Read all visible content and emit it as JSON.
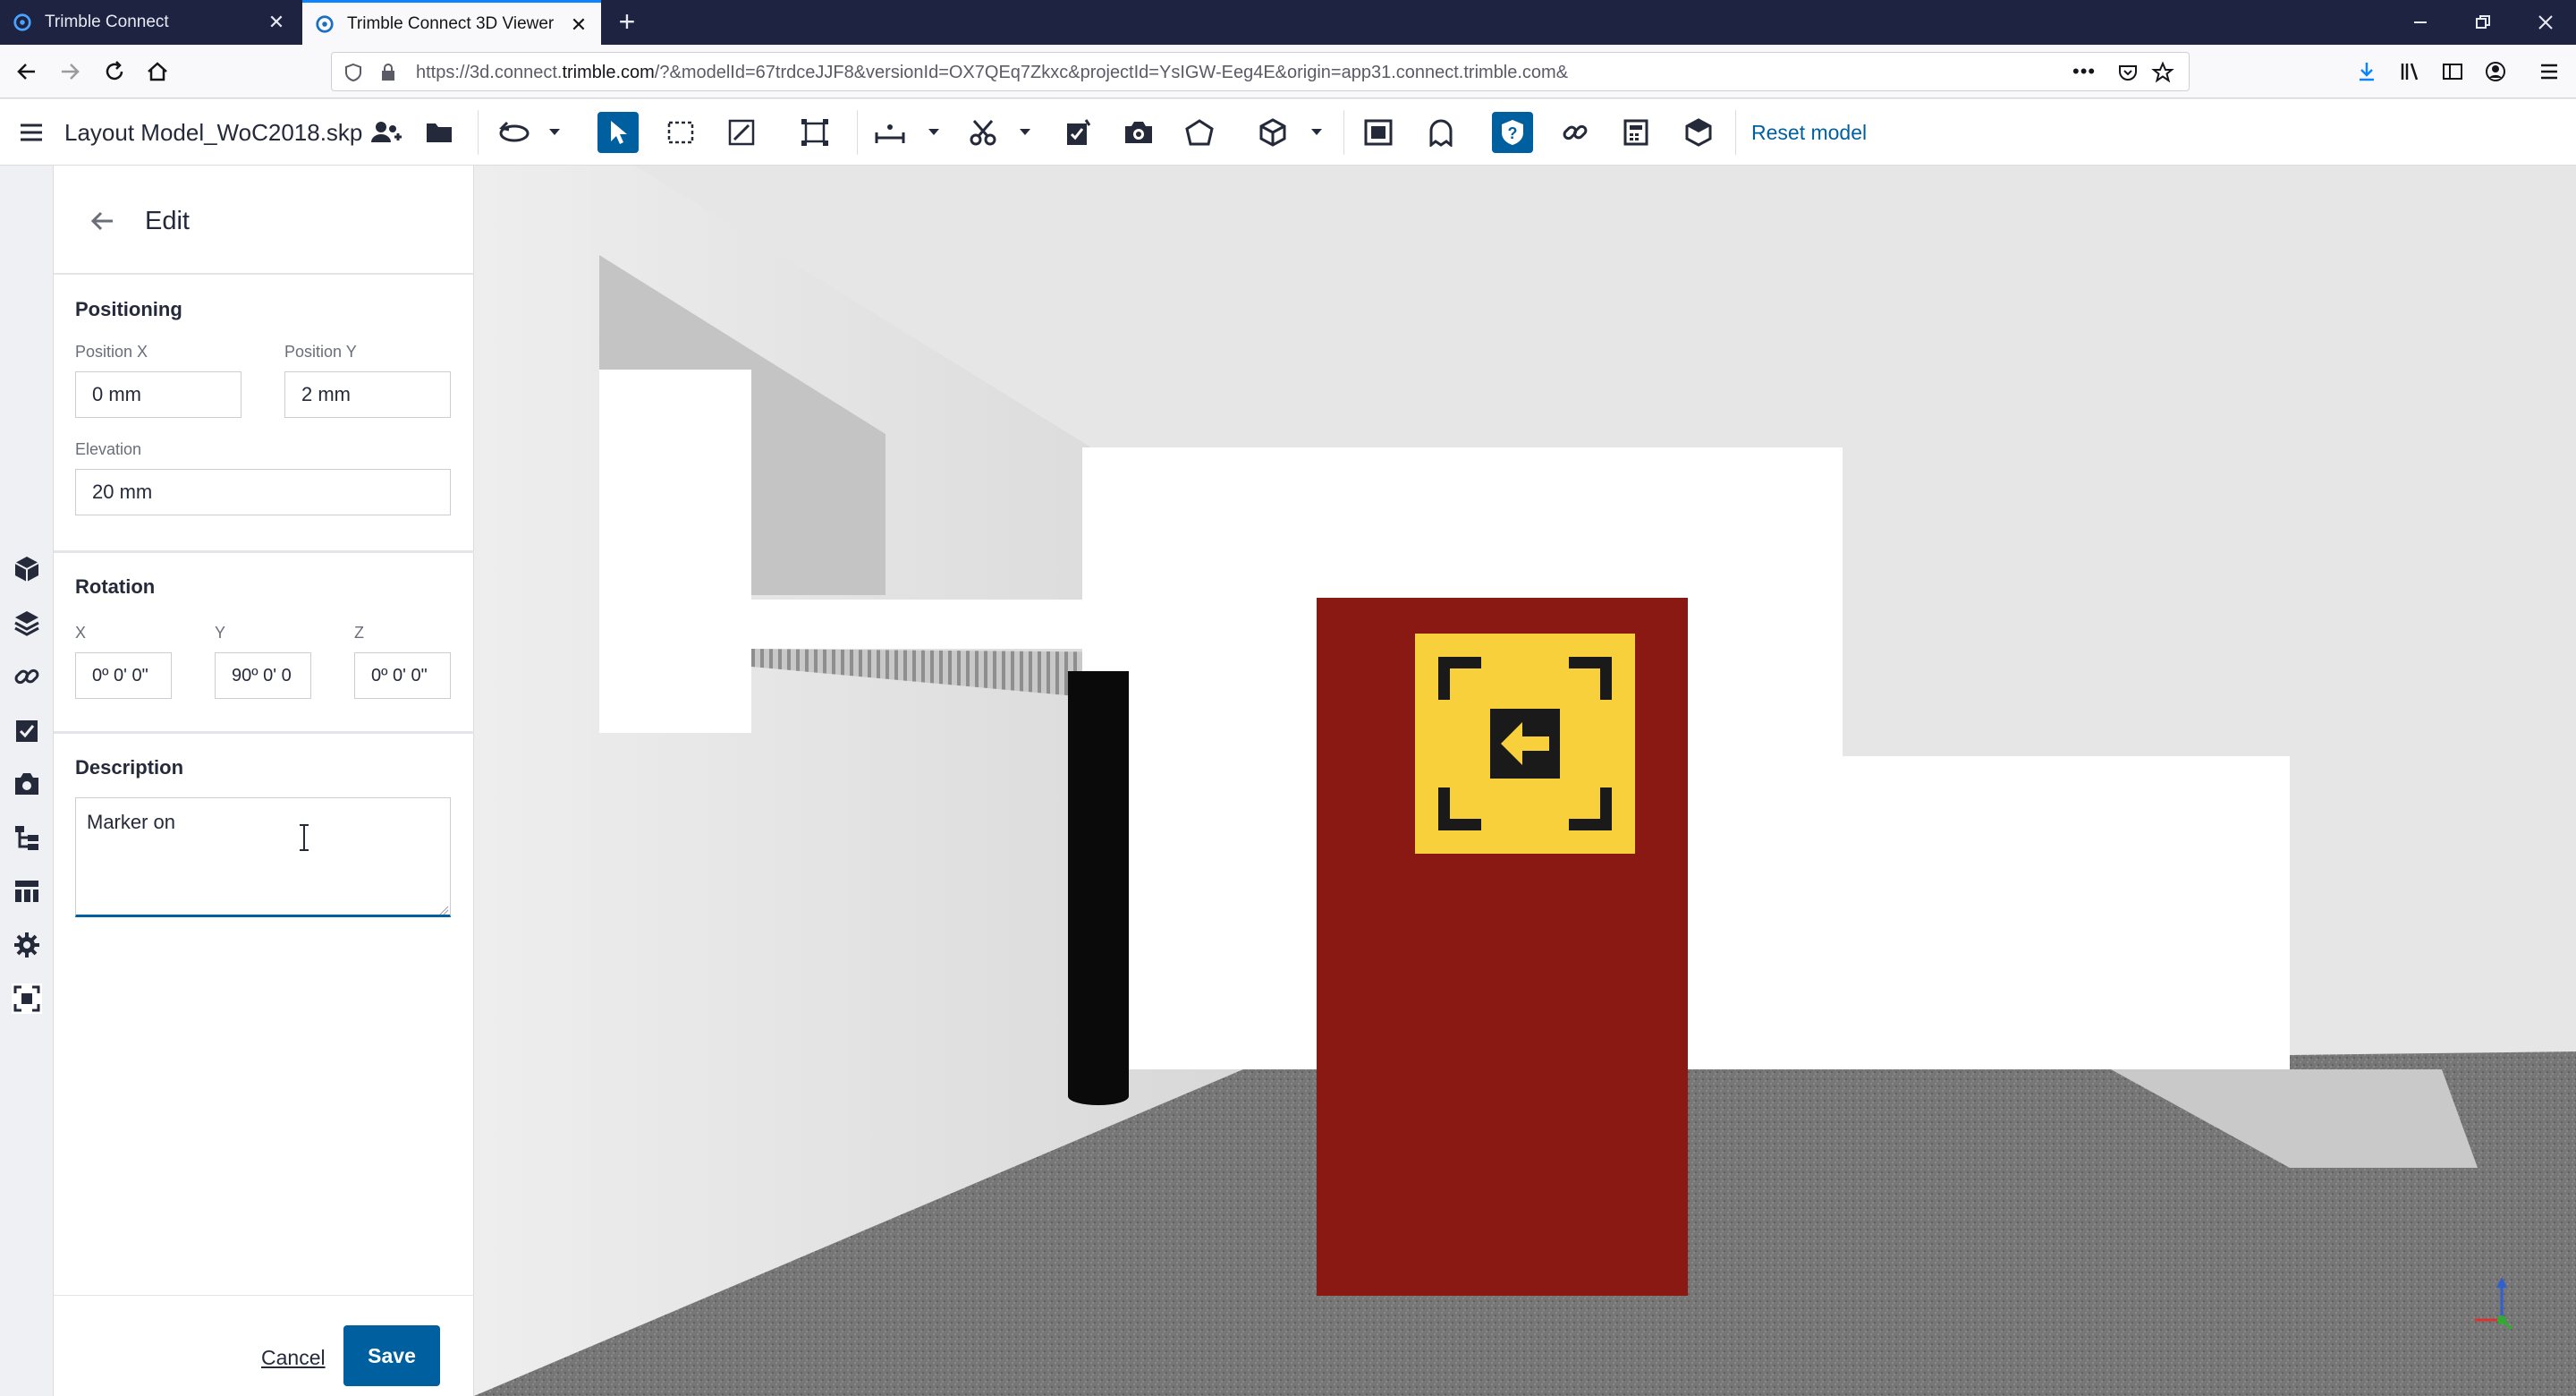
{
  "browser": {
    "tabs": [
      {
        "title": "Trimble Connect",
        "active": false
      },
      {
        "title": "Trimble Connect 3D Viewer",
        "active": true
      }
    ],
    "url_prefix": "https://3d.connect.",
    "url_domain": "trimble.com",
    "url_suffix": "/?&modelId=67trdceJJF8&versionId=OX7QEq7Zkxc&projectId=YsIGW-Eeg4E&origin=app31.connect.trimble.com&"
  },
  "toolbar": {
    "model_name": "Layout Model_WoC2018.skp",
    "reset_label": "Reset model",
    "accent_color": "#005f9e"
  },
  "panel": {
    "title": "Edit",
    "positioning": {
      "title": "Positioning",
      "position_x_label": "Position X",
      "position_x_value": "0 mm",
      "position_y_label": "Position Y",
      "position_y_value": "2 mm",
      "elevation_label": "Elevation",
      "elevation_value": "20 mm"
    },
    "rotation": {
      "title": "Rotation",
      "x_label": "X",
      "x_value": "0º 0' 0\"",
      "y_label": "Y",
      "y_value": "90º 0' 0",
      "z_label": "Z",
      "z_value": "0º 0' 0\""
    },
    "description": {
      "title": "Description",
      "value": "Marker on"
    },
    "cancel_label": "Cancel",
    "save_label": "Save"
  },
  "viewport": {
    "marker_panel_color": "#8b1913",
    "marker_sign_color": "#f7d03c"
  }
}
